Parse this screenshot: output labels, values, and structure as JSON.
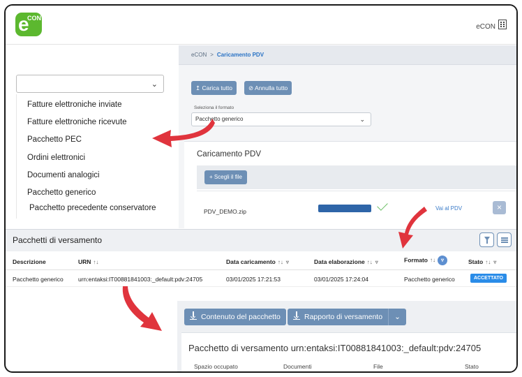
{
  "header": {
    "logo_letter": "e",
    "logo_sup": "CON",
    "right_label": "eCON",
    "right_icon": "building-icon"
  },
  "sidebar": {
    "select_value": "",
    "items": [
      {
        "label": "Fatture elettroniche inviate"
      },
      {
        "label": "Fatture elettroniche ricevute"
      },
      {
        "label": "Pacchetto PEC"
      },
      {
        "label": "Ordini elettronici"
      },
      {
        "label": "Documenti analogici"
      },
      {
        "label": "Pacchetto generico"
      },
      {
        "label": "Pacchetto precedente conservatore"
      }
    ]
  },
  "breadcrumb": {
    "root": "eCON",
    "separator": ">",
    "current": "Caricamento PDV"
  },
  "toolbar": {
    "upload_all": "Carica tutto",
    "cancel_all": "Annulla tutto"
  },
  "format": {
    "label": "Seleziona il formato",
    "value": "Pacchetto generico"
  },
  "upload": {
    "title": "Caricamento PDV",
    "choose_label": "Scegli il file",
    "file_name": "PDV_DEMO.zip",
    "progress": 1.0,
    "view_link": "Vai al PDV",
    "remove_label": "×"
  },
  "pacchetti": {
    "title": "Pacchetti di versamento",
    "columns": {
      "descrizione": "Descrizione",
      "urn": "URN",
      "data_caricamento": "Data caricamento",
      "data_elaborazione": "Data elaborazione",
      "formato": "Formato",
      "stato": "Stato"
    },
    "rows": [
      {
        "descrizione": "Pacchetto generico",
        "urn": "urn:entaksi:IT00881841003:_default:pdv:24705",
        "data_caricamento": "03/01/2025 17:21:53",
        "data_elaborazione": "03/01/2025 17:24:04",
        "formato": "Pacchetto generico",
        "stato": "ACCETTATO"
      }
    ]
  },
  "detail": {
    "content_button": "Contenuto del pacchetto",
    "report_button": "Rapporto di versamento",
    "title": "Pacchetto di versamento urn:entaksi:IT00881841003:_default:pdv:24705",
    "columns": [
      "Spazio occupato",
      "Documenti",
      "File",
      "Stato"
    ]
  },
  "colors": {
    "brand": "#5cb82f",
    "button": "#6d8fb5",
    "accent": "#2a8ce8",
    "arrow": "#e0343d"
  }
}
